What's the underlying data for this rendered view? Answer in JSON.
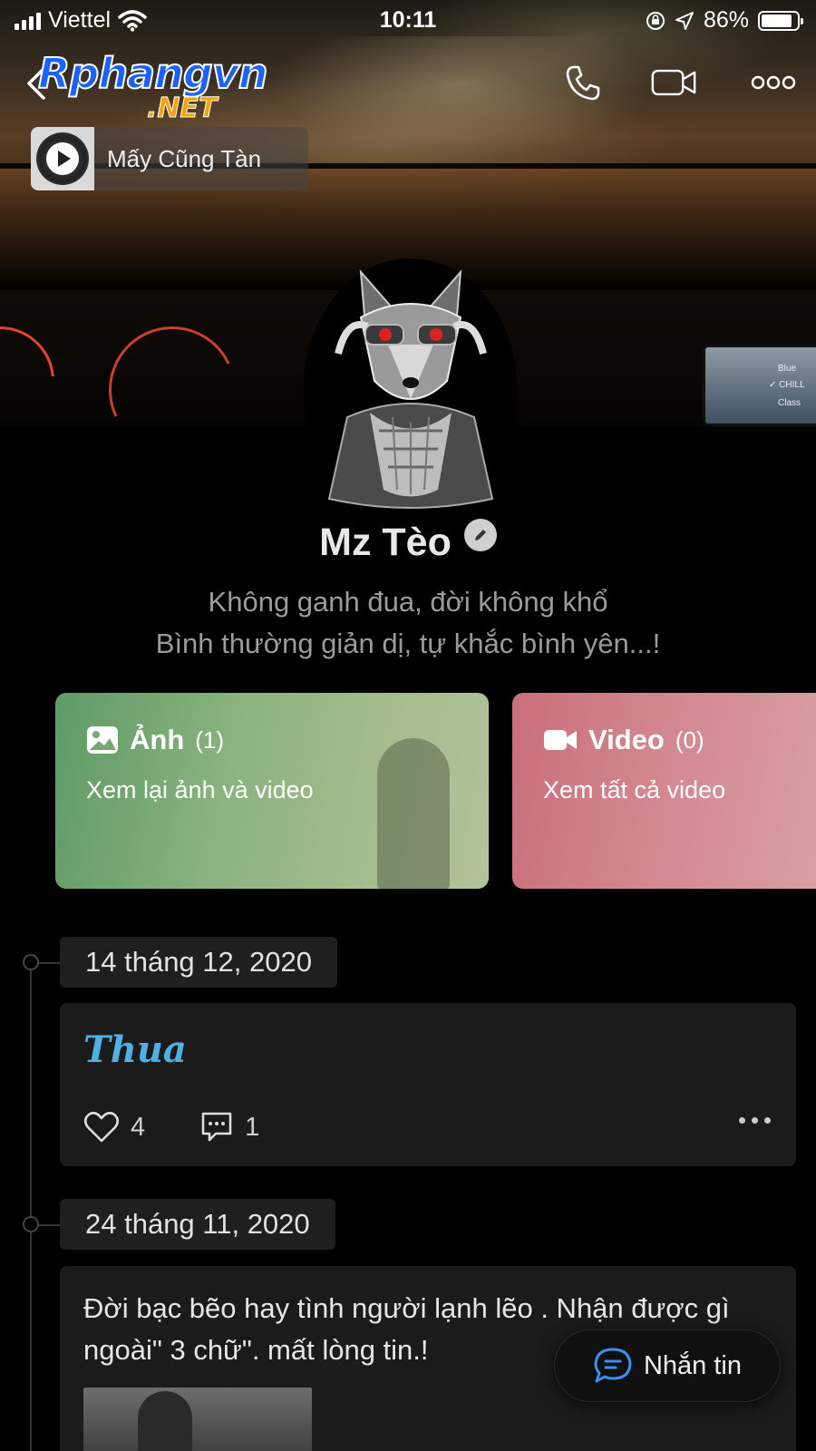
{
  "status_bar": {
    "carrier": "Viettel",
    "time": "10:11",
    "battery": "86%"
  },
  "header": {
    "logo_main": "Rphangvn",
    "logo_suffix": ".NET",
    "icons": [
      "back-icon",
      "phone-icon",
      "video-call-icon",
      "more-icon"
    ]
  },
  "music": {
    "title": "Mấy Cũng Tàn"
  },
  "profile": {
    "name": "Mz Tèo",
    "bio_line1": "Không ganh đua, đời không khổ",
    "bio_line2": "Bình thường giản dị, tự khắc bình yên...!"
  },
  "media": {
    "photos": {
      "label": "Ảnh",
      "count": "(1)",
      "subtitle": "Xem lại ảnh và video"
    },
    "videos": {
      "label": "Video",
      "count": "(0)",
      "subtitle": "Xem tất cả video"
    }
  },
  "timeline": [
    {
      "date": "14 tháng 12, 2020",
      "text": "Thua",
      "likes": "4",
      "comments": "1"
    },
    {
      "date": "24 tháng 11, 2020",
      "text": "Đời bạc bẽo hay tình người lạnh lẽo . Nhận được gì ngoài\" 3 chữ\". mất lòng tin.!"
    }
  ],
  "message_button": {
    "label": "Nhắn tin"
  },
  "colors": {
    "accent_blue": "#4fb0e6",
    "photo_card": "#8ab37f",
    "video_card": "#d48a92"
  }
}
